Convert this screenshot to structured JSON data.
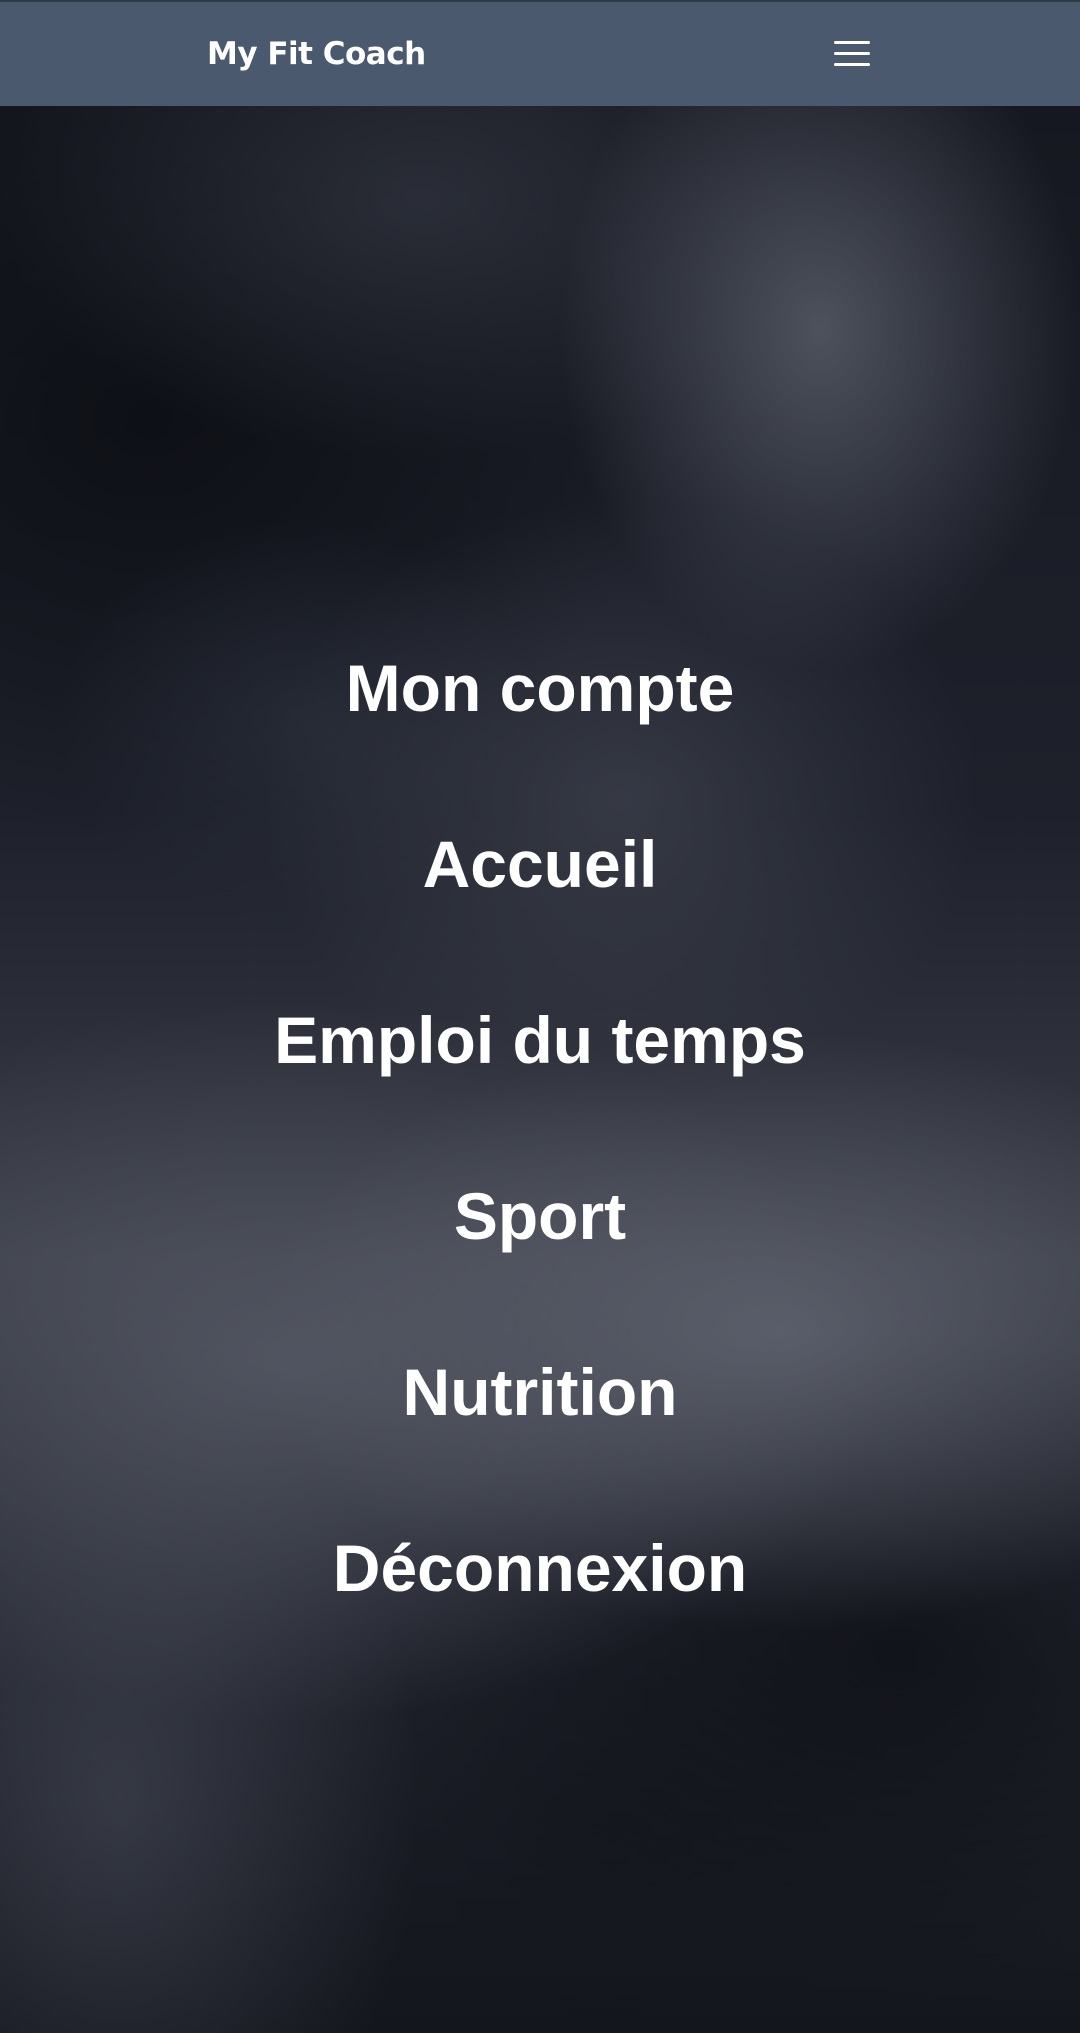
{
  "header": {
    "brand": "My Fit Coach",
    "menu_icon": "hamburger-menu-icon"
  },
  "nav": {
    "items": [
      {
        "label": "Mon compte"
      },
      {
        "label": "Accueil"
      },
      {
        "label": "Emploi du temps"
      },
      {
        "label": "Sport"
      },
      {
        "label": "Nutrition"
      },
      {
        "label": "Déconnexion"
      }
    ]
  },
  "colors": {
    "topbar": "#4a596d",
    "text": "#ffffff"
  }
}
